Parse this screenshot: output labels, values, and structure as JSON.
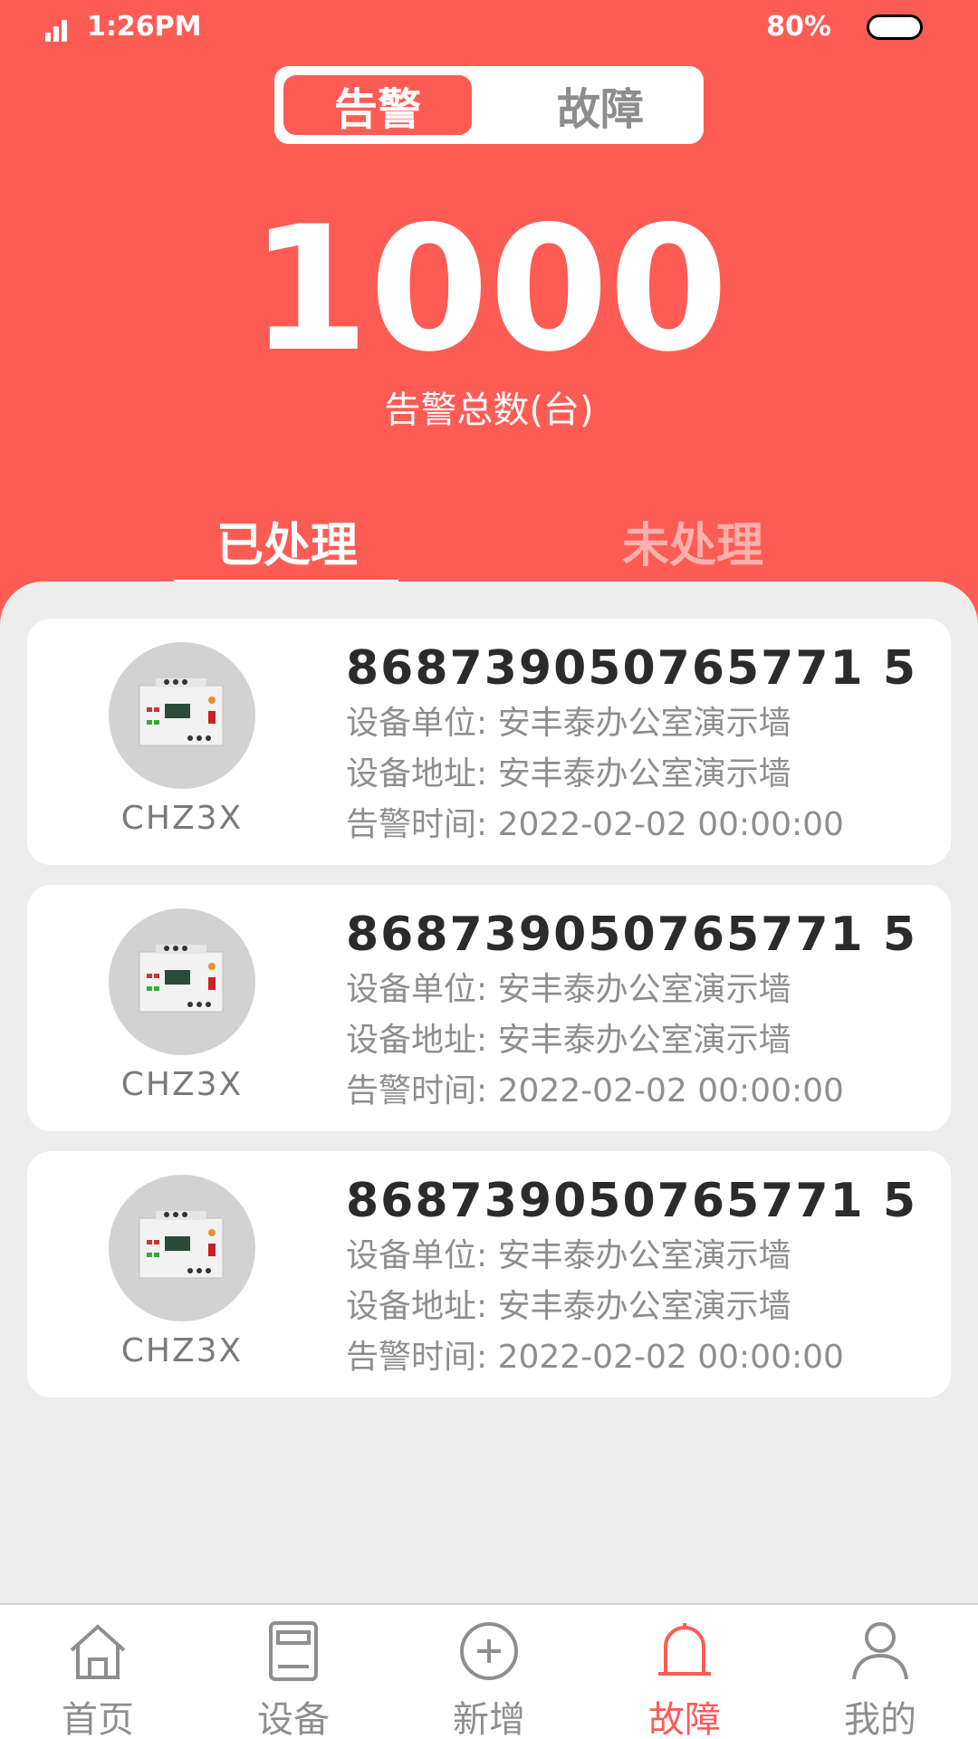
{
  "status_bar": {
    "time": "1:26PM",
    "battery": "80%"
  },
  "segment": {
    "active": "告警",
    "inactive": "故障"
  },
  "summary": {
    "total": "1000",
    "label": "告警总数(台)"
  },
  "tabs": {
    "processed": "已处理",
    "unprocessed": "未处理"
  },
  "records": [
    {
      "serial": "868739050765771 5",
      "model": "CHZ3X",
      "unit": "设备单位: 安丰泰办公室演示墙",
      "address": "设备地址: 安丰泰办公室演示墙",
      "alarm_time": "告警时间: 2022-02-02   00:00:00"
    },
    {
      "serial": "868739050765771 5",
      "model": "CHZ3X",
      "unit": "设备单位: 安丰泰办公室演示墙",
      "address": "设备地址: 安丰泰办公室演示墙",
      "alarm_time": "告警时间: 2022-02-02   00:00:00"
    },
    {
      "serial": "868739050765771 5",
      "model": "CHZ3X",
      "unit": "设备单位: 安丰泰办公室演示墙",
      "address": "设备地址: 安丰泰办公室演示墙",
      "alarm_time": "告警时间: 2022-02-02   00:00:00"
    }
  ],
  "nav": [
    {
      "label": "首页",
      "icon": "home-icon"
    },
    {
      "label": "设备",
      "icon": "device-icon"
    },
    {
      "label": "新增",
      "icon": "add-circle-icon"
    },
    {
      "label": "故障",
      "icon": "bell-icon"
    },
    {
      "label": "我的",
      "icon": "user-icon"
    }
  ],
  "colors": {
    "accent": "#fd5c55",
    "inactive": "#8e8e8e"
  }
}
